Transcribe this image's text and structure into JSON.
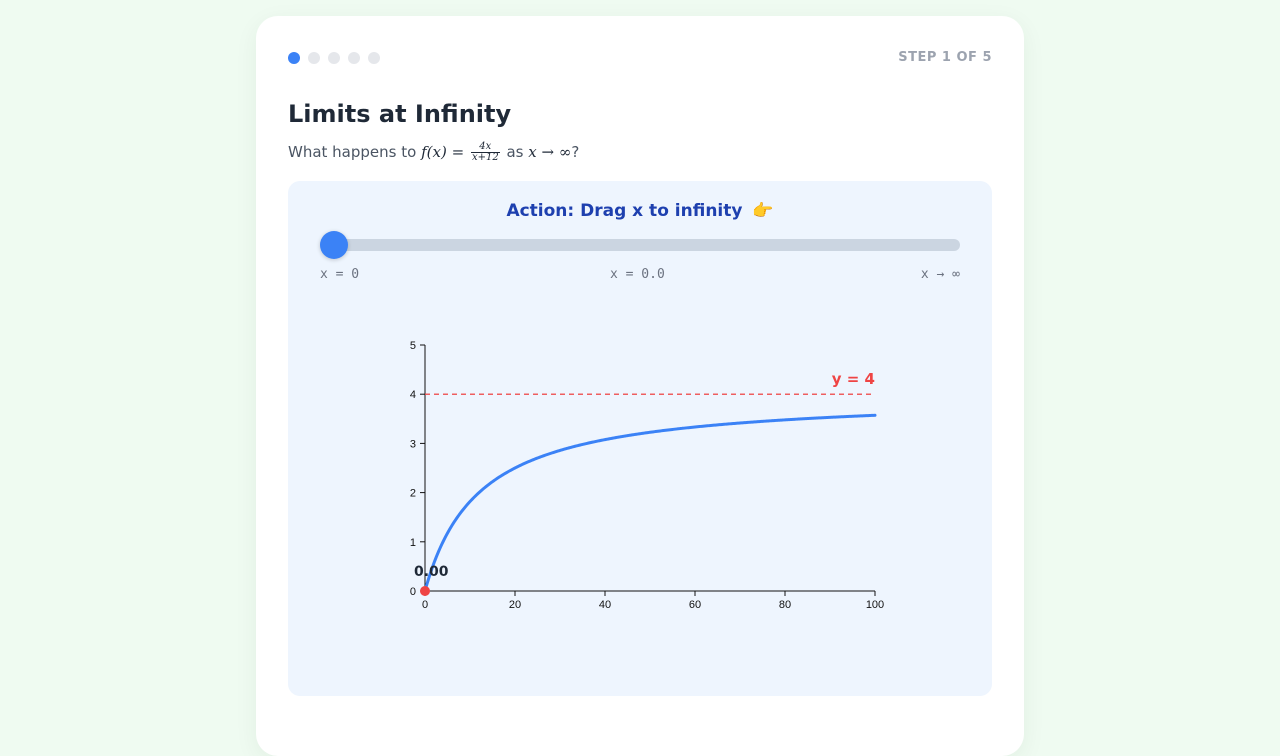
{
  "progress": {
    "total_steps": 5,
    "current_step": 1,
    "step_label": "STEP 1 OF 5",
    "active_color": "#3b82f6",
    "inactive_color": "#e5e7eb"
  },
  "lesson": {
    "title": "Limits at Infinity",
    "question_prefix": "What happens to",
    "function_lhs": "f(x) =",
    "fraction_numerator": "4x",
    "fraction_denominator": "x+12",
    "question_mid": "as",
    "limit_expr": "x → ∞",
    "question_suffix": "?"
  },
  "panel": {
    "action_text": "Action: Drag x to infinity",
    "action_icon": "pointing-hand-icon",
    "action_emoji": "👉",
    "slider": {
      "min_label": "x = 0",
      "current_label": "x = 0.0",
      "max_label": "x → ∞",
      "value_fraction": 0
    }
  },
  "chart_data": {
    "type": "line",
    "title": "",
    "xlabel": "",
    "ylabel": "",
    "xlim": [
      0,
      100
    ],
    "ylim": [
      0,
      5
    ],
    "x_ticks": [
      0,
      20,
      40,
      60,
      80,
      100
    ],
    "y_ticks": [
      0,
      1,
      2,
      3,
      4,
      5
    ],
    "function": "4x/(x+12)",
    "series": [
      {
        "color": "#3b82f6",
        "x": [
          0,
          1,
          2,
          4,
          6,
          8,
          10,
          15,
          20,
          30,
          40,
          50,
          60,
          70,
          80,
          90,
          100
        ],
        "y": [
          0,
          0.308,
          0.571,
          1.0,
          1.333,
          1.6,
          1.818,
          2.222,
          2.5,
          2.857,
          3.077,
          3.226,
          3.333,
          3.415,
          3.478,
          3.529,
          3.571
        ]
      }
    ],
    "asymptote": {
      "y": 4,
      "label": "y = 4",
      "color": "#ef4444"
    },
    "current_point": {
      "x": 0,
      "y": 0,
      "label": "0.00",
      "color": "#ef4444"
    },
    "grid": false
  }
}
